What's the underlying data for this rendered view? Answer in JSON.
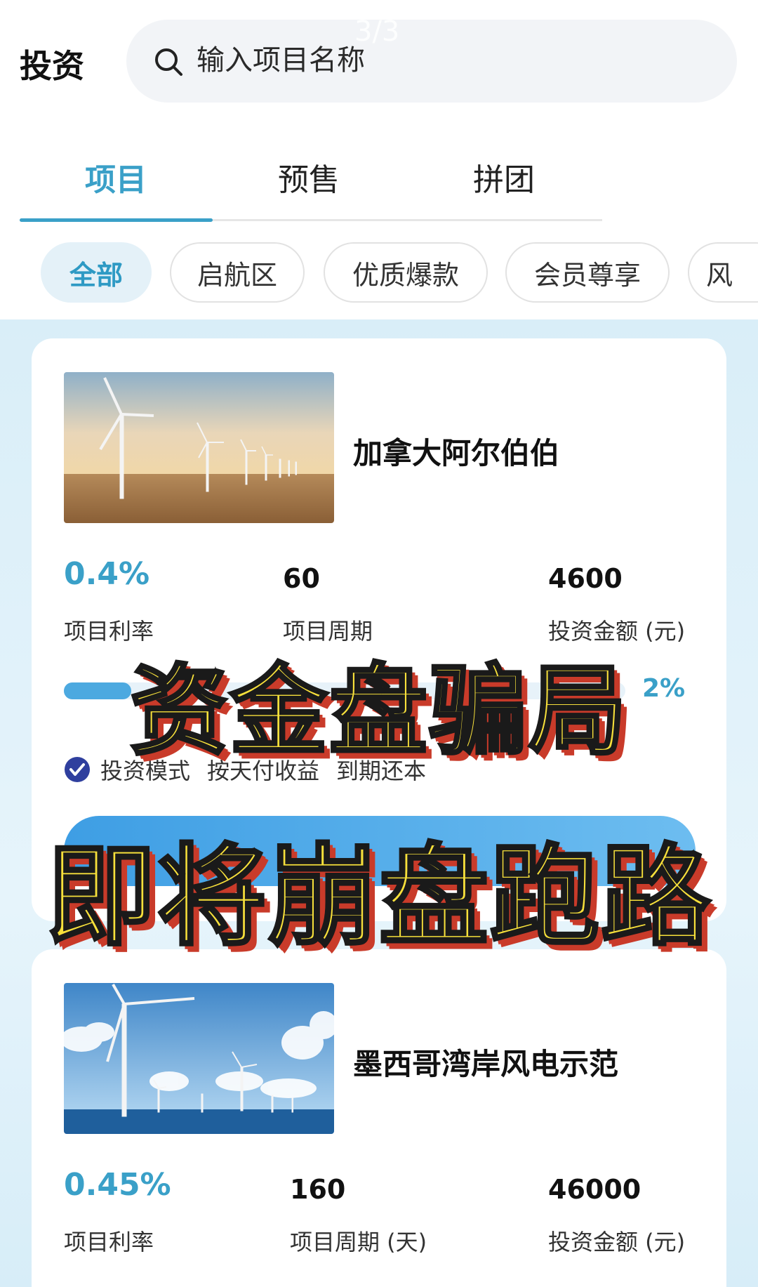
{
  "header": {
    "title": "投资",
    "search_placeholder": "输入项目名称",
    "page_indicator": "3/3"
  },
  "tabs": [
    {
      "label": "项目",
      "active": true
    },
    {
      "label": "预售",
      "active": false
    },
    {
      "label": "拼团",
      "active": false
    }
  ],
  "filters": [
    {
      "label": "全部",
      "active": true
    },
    {
      "label": "启航区",
      "active": false
    },
    {
      "label": "优质爆款",
      "active": false
    },
    {
      "label": "会员尊享",
      "active": false
    },
    {
      "label": "风",
      "active": false
    }
  ],
  "projects": [
    {
      "name": "加拿大阿尔伯伯",
      "image": "wind-turbines-plain",
      "rate": "0.4%",
      "rate_label": "项目利率",
      "period": "60",
      "period_label": "项目周期",
      "amount": "4600",
      "amount_label": "投资金额 (元)",
      "progress_text": "2%",
      "progress": 0.02,
      "mode_label": "投资模式",
      "payout": "按天付收益",
      "principal": "到期还本"
    },
    {
      "name": "墨西哥湾岸风电示范",
      "image": "offshore-wind-turbines",
      "rate": "0.45%",
      "rate_label": "项目利率",
      "period": "160",
      "period_label": "项目周期 (天)",
      "amount": "46000",
      "amount_label": "投资金额 (元)"
    }
  ],
  "overlay": {
    "line1": "资金盘骗局",
    "line2": "即将崩盘跑路"
  },
  "colors": {
    "accent": "#3aa0c8",
    "overlay_text": "#f7e03b",
    "overlay_shadow": "#c93b2a"
  }
}
